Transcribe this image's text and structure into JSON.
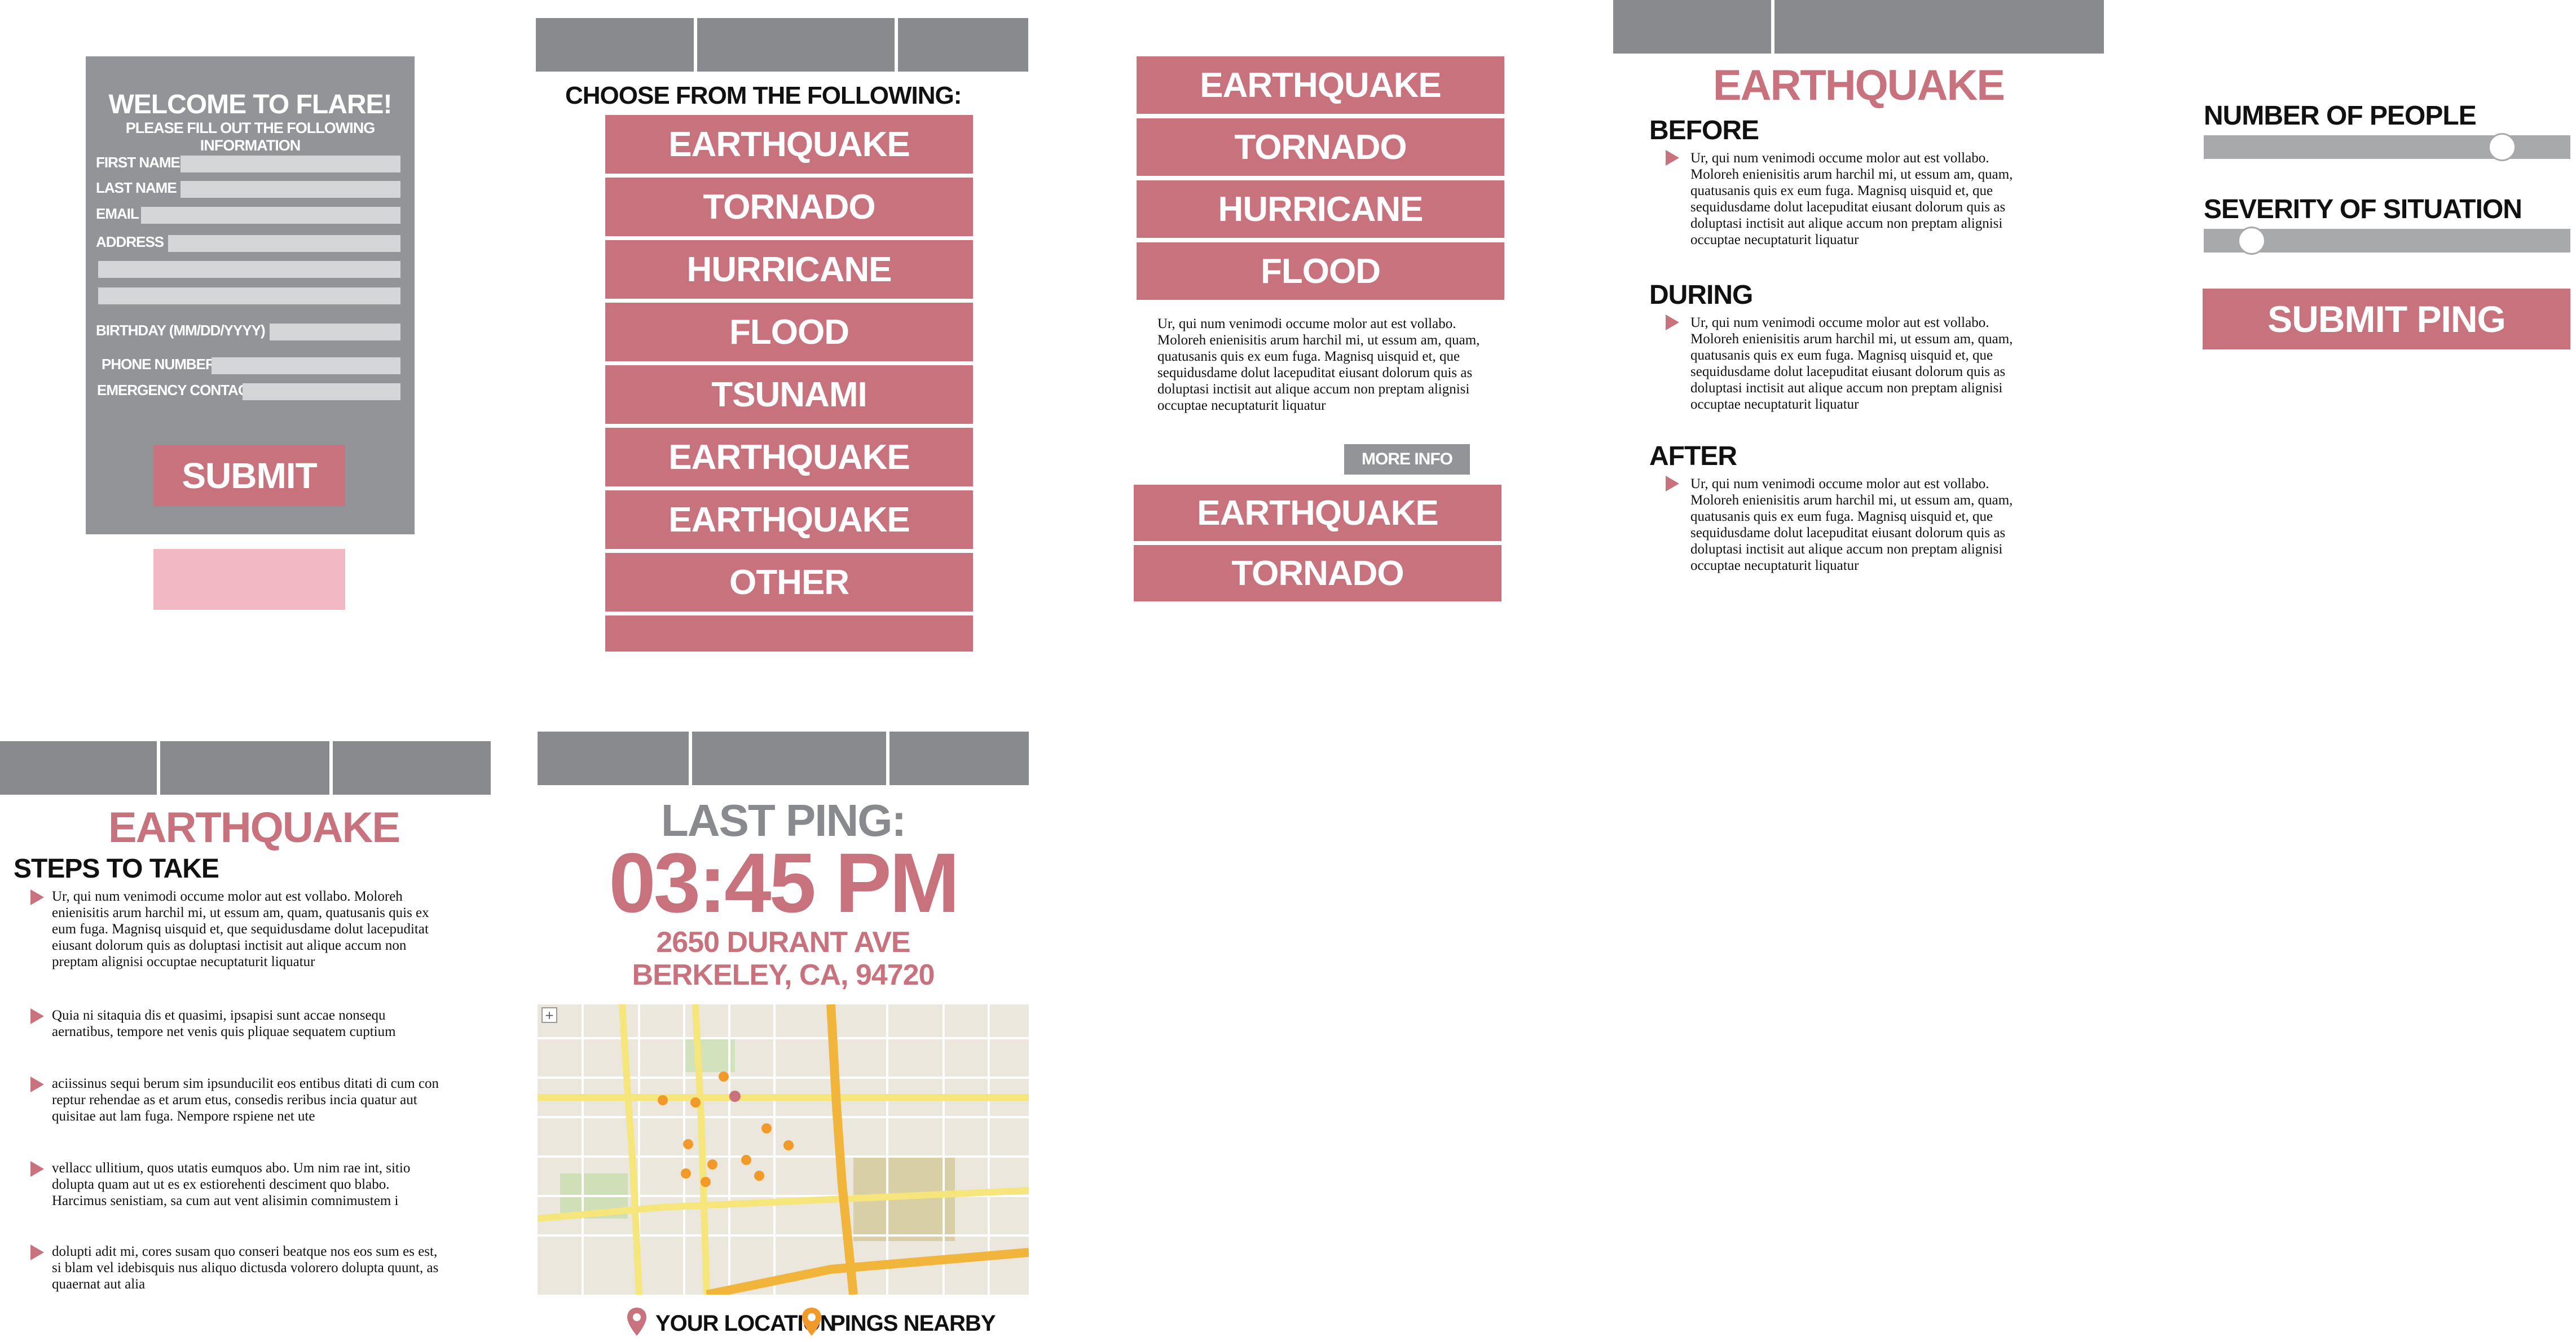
{
  "welcome": {
    "title": "WELCOME TO FLARE!",
    "subtitle": "PLEASE FILL OUT THE FOLLOWING INFORMATION",
    "fields": {
      "first_name": "FIRST NAME",
      "last_name": "LAST NAME",
      "email": "EMAIL",
      "address": "ADDRESS",
      "birthday": "BIRTHDAY (MM/DD/YYYY)",
      "phone": "PHONE NUMBER",
      "emergency": "EMERGENCY CONTACT"
    },
    "submit_label": "SUBMIT"
  },
  "choose": {
    "heading": "CHOOSE FROM THE FOLLOWING:",
    "items": [
      "EARTHQUAKE",
      "TORNADO",
      "HURRICANE",
      "FLOOD",
      "TSUNAMI",
      "EARTHQUAKE",
      "EARTHQUAKE",
      "OTHER"
    ]
  },
  "expanded": {
    "items_top": [
      "EARTHQUAKE",
      "TORNADO",
      "HURRICANE",
      "FLOOD"
    ],
    "description": "Ur, qui num venimodi occume molor aut est vollabo. Moloreh enienisitis arum harchil mi, ut essum am, quam, quatusanis quis ex eum fuga. Magnisq uisquid et, que sequidusdame dolut lacepuditat eiusant dolorum quis as doluptasi inctisit aut alique accum non preptam alignisi occuptae necuptaturit liquatur",
    "more_info_label": "MORE INFO",
    "items_bottom": [
      "EARTHQUAKE",
      "TORNADO"
    ]
  },
  "detail": {
    "title": "EARTHQUAKE",
    "sections": [
      {
        "heading": "BEFORE",
        "text": "Ur, qui num venimodi occume molor aut est vollabo. Moloreh enienisitis arum harchil mi, ut essum am, quam, quatusanis quis ex eum fuga. Magnisq uisquid et, que sequidusdame dolut lacepuditat eiusant dolorum quis as doluptasi inctisit aut alique accum non preptam alignisi occuptae necuptaturit liquatur"
      },
      {
        "heading": "DURING",
        "text": "Ur, qui num venimodi occume molor aut est vollabo. Moloreh enienisitis arum harchil mi, ut essum am, quam, quatusanis quis ex eum fuga. Magnisq uisquid et, que sequidusdame dolut lacepuditat eiusant dolorum quis as doluptasi inctisit aut alique accum non preptam alignisi occuptae necuptaturit liquatur"
      },
      {
        "heading": "AFTER",
        "text": "Ur, qui num venimodi occume molor aut est vollabo. Moloreh enienisitis arum harchil mi, ut essum am, quam, quatusanis quis ex eum fuga. Magnisq uisquid et, que sequidusdame dolut lacepuditat eiusant dolorum quis as doluptasi inctisit aut alique accum non preptam alignisi occuptae necuptaturit liquatur"
      }
    ]
  },
  "ping_form": {
    "people_label": "NUMBER OF PEOPLE",
    "people_level": 0.84,
    "severity_label": "SEVERITY OF SITUATION",
    "severity_level": 0.1,
    "submit_label": "SUBMIT PING"
  },
  "steps": {
    "title": "EARTHQUAKE",
    "heading": "STEPS TO TAKE",
    "items": [
      "Ur, qui num venimodi occume molor aut est vollabo. Moloreh enienisitis arum harchil mi, ut essum am, quam, quatusanis quis ex eum fuga. Magnisq uisquid et, que sequidusdame dolut lacepuditat eiusant dolorum quis as doluptasi inctisit aut alique accum non preptam alignisi occuptae necuptaturit liquatur",
      "Quia ni sitaquia dis et quasimi, ipsapisi sunt accae nonsequ aernatibus, tempore net venis quis pliquae sequatem cuptium",
      "aciissinus sequi berum sim ipsunducilit eos entibus ditati di cum con reptur rehendae as et arum etus, consedis reribus incia quatur aut quisitae aut lam fuga. Nempore rspiene net ute",
      "vellacc ullitium, quos utatis eumquos abo. Um nim rae int, sitio dolupta quam aut ut es ex estiorehenti desciment quo blabo. Harcimus senistiam, sa cum aut vent alisimin comnimustem i",
      "dolupti adit mi, cores susam quo conseri beatque nos eos sum es est, si blam vel idebisquis nus aliquo dictusda volorero dolupta quunt, as quaernat aut alia"
    ]
  },
  "last_ping": {
    "label": "LAST PING:",
    "time": "03:45 PM",
    "address_line1": "2650 DURANT AVE",
    "address_line2": "BERKELEY, CA, 94720",
    "legend_you": "YOUR LOCATION",
    "legend_pings": "PINGS NEARBY"
  },
  "colors": {
    "accent": "#c8727e",
    "gray": "#888a8d",
    "light_pink": "#f2b8c4",
    "pin_orange": "#f19a2a"
  }
}
